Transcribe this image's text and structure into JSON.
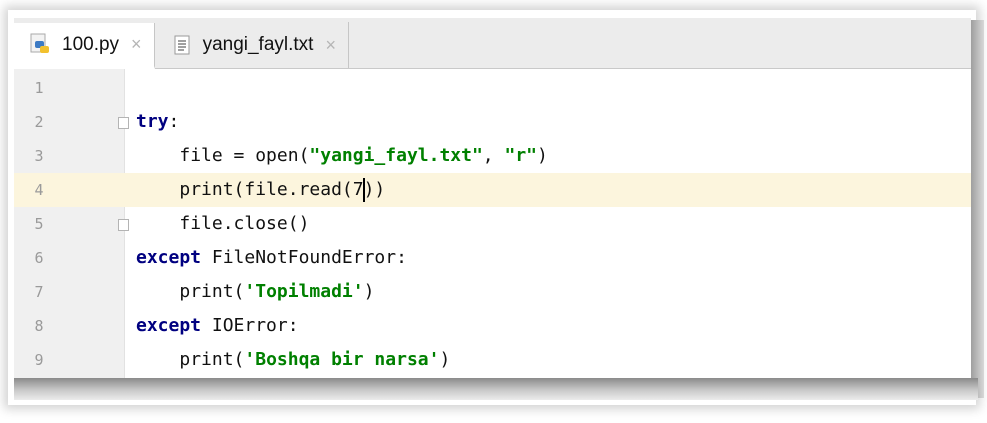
{
  "tabs": [
    {
      "label": "100.py",
      "icon": "python-file-icon",
      "close": "×",
      "active": true
    },
    {
      "label": "yangi_fayl.txt",
      "icon": "text-file-icon",
      "close": "×",
      "active": false
    }
  ],
  "editor": {
    "current_line": 4,
    "lines": [
      {
        "num": "1"
      },
      {
        "num": "2",
        "kw": "try",
        "rest": ":"
      },
      {
        "num": "3",
        "indent": "    ",
        "pre": "file = open(",
        "s1": "\"yangi_fayl.txt\"",
        "mid": ", ",
        "s2": "\"r\"",
        "post": ")"
      },
      {
        "num": "4",
        "indent": "    ",
        "pre": "print(file.read(7",
        "post": "))"
      },
      {
        "num": "5",
        "indent": "    ",
        "text": "file.close()"
      },
      {
        "num": "6",
        "kw": "except",
        "rest": " FileNotFoundError:"
      },
      {
        "num": "7",
        "indent": "    ",
        "pre": "print(",
        "s1": "'Topilmadi'",
        "post": ")"
      },
      {
        "num": "8",
        "kw": "except",
        "rest": " IOError:"
      },
      {
        "num": "9",
        "indent": "    ",
        "pre": "print(",
        "s1": "'Boshqa bir narsa'",
        "post": ")"
      }
    ]
  },
  "colors": {
    "keyword": "#000080",
    "string": "#008000",
    "current_line": "#fcf5dd"
  }
}
